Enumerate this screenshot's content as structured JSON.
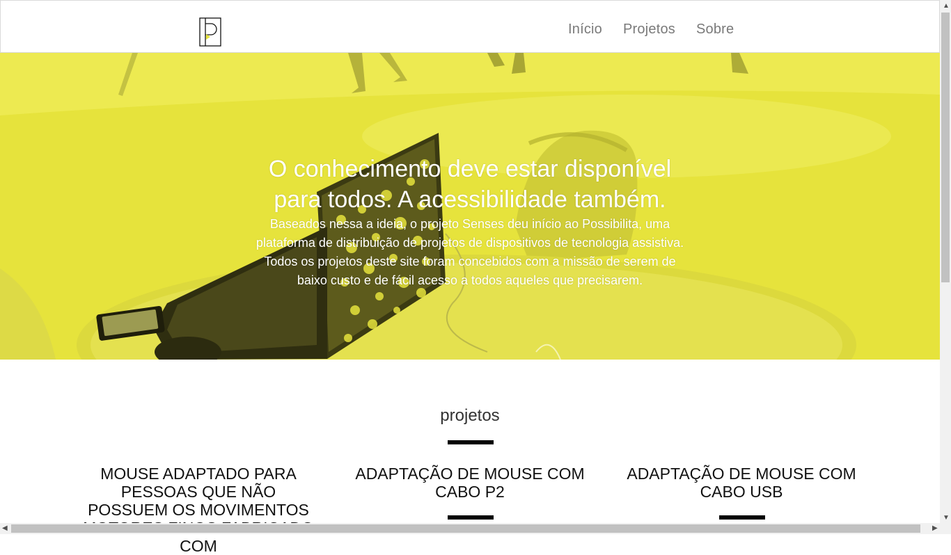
{
  "nav": {
    "logo_icon": "possibilita-logo-icon",
    "links": [
      "Início",
      "Projetos",
      "Sobre"
    ]
  },
  "hero": {
    "title": "O conhecimento deve estar disponível para todos. A acessibilidade também.",
    "description": "Baseados nessa a ideia, o projeto Senses deu início ao Possibilita, uma plataforma de distribuição de projetos de dispositivos de tecnologia assistiva. Todos os projetos deste site foram concebidos com a missão de serem de baixo custo e de fácil acesso a todos aqueles que precisarem."
  },
  "projects": {
    "heading": "projetos",
    "items": [
      "Mouse adaptado para pessoas que não possuem os movimentos motores finos fabricado com",
      "Adaptação de mouse com cabo P2",
      "Adaptação de mouse com cabo USB"
    ]
  },
  "colors": {
    "overlay_yellow": "#e6e33c",
    "text_dark": "#111111",
    "nav_text": "#7a7a7a"
  }
}
